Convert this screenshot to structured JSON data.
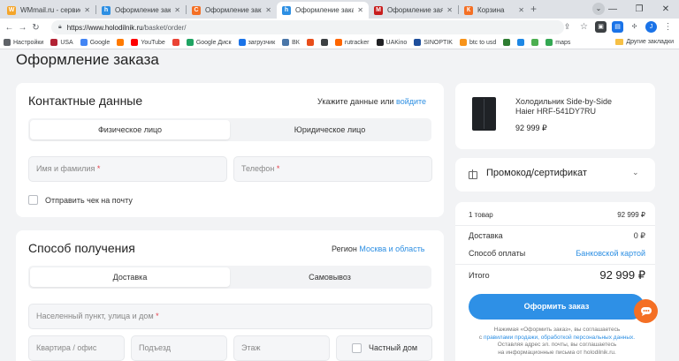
{
  "browser": {
    "tabs": [
      {
        "title": "WMmail.ru - сервис по",
        "favicon_color": "#f4a52a",
        "favicon": "W"
      },
      {
        "title": "Оформление заказа | и",
        "favicon_color": "#2d8fe3",
        "favicon": "h"
      },
      {
        "title": "Оформление заказа",
        "favicon_color": "#f46f24",
        "favicon": "C"
      },
      {
        "title": "Оформление заказа | и",
        "favicon_color": "#2d8fe3",
        "favicon": "h"
      },
      {
        "title": "Оформление заявки",
        "favicon_color": "#c81d1d",
        "favicon": "M"
      },
      {
        "title": "Корзина",
        "favicon_color": "#f46f24",
        "favicon": "К"
      }
    ],
    "url_host": "https://www.holodilnik.ru",
    "url_path": "/basket/order/",
    "bookmarks": [
      {
        "label": "Настройки",
        "color": "#5f6368"
      },
      {
        "label": "USA",
        "color": "#b22234"
      },
      {
        "label": "Google",
        "color": "#4285f4"
      },
      {
        "label": "",
        "color": "#ff7a00"
      },
      {
        "label": "YouTube",
        "color": "#ff0000"
      },
      {
        "label": "",
        "color": "#ea4335"
      },
      {
        "label": "Google Диск",
        "color": "#1fa463"
      },
      {
        "label": "загрузчик",
        "color": "#1a73e8"
      },
      {
        "label": "ВК",
        "color": "#4a76a8"
      },
      {
        "label": "",
        "color": "#e84e1b"
      },
      {
        "label": "",
        "color": "#3c4043"
      },
      {
        "label": "rutracker",
        "color": "#ff6600"
      },
      {
        "label": "UAKino",
        "color": "#202124"
      },
      {
        "label": "SINOPTIK",
        "color": "#1e4f9c"
      },
      {
        "label": "btc to usd",
        "color": "#f7931a"
      },
      {
        "label": "",
        "color": "#2e7d32"
      },
      {
        "label": "",
        "color": "#1e88e5"
      },
      {
        "label": "",
        "color": "#4caf50"
      },
      {
        "label": "maps",
        "color": "#34a853"
      }
    ],
    "other_bookmarks": "Другие закладки"
  },
  "page": {
    "title": "Оформление заказа",
    "contacts": {
      "title": "Контактные данные",
      "hint": "Укажите данные или",
      "hint_link": "войдите",
      "tab_individual": "Физическое лицо",
      "tab_legal": "Юридическое лицо",
      "name_placeholder": "Имя и фамилия",
      "phone_placeholder": "Телефон",
      "required_mark": "*",
      "receipt_label": "Отправить чек на почту"
    },
    "delivery": {
      "title": "Способ получения",
      "region_label": "Регион",
      "region_value": "Москва и область",
      "tab_delivery": "Доставка",
      "tab_pickup": "Самовывоз",
      "address_placeholder": "Населенный пункт, улица и дом",
      "apartment_placeholder": "Квартира / офис",
      "entrance_placeholder": "Подъезд",
      "floor_placeholder": "Этаж",
      "private_house_label": "Частный дом"
    },
    "product": {
      "name": "Холодильник Side-by-Side Haier HRF-541DY7RU",
      "price": "92 999 ₽"
    },
    "promo": {
      "title": "Промокод/сертификат",
      "chevron": "⌄"
    },
    "summary": {
      "items_label": "1 товар",
      "items_value": "92 999 ₽",
      "delivery_label": "Доставка",
      "delivery_value": "0 ₽",
      "payment_label": "Способ оплаты",
      "payment_value": "Банковской картой",
      "total_label": "Итого",
      "total_value": "92 999 ₽",
      "order_button": "Оформить заказ",
      "legal_line1": "Нажимая «Оформить заказ», вы соглашаетесь",
      "legal_prefix": "с ",
      "legal_link": "правилами продажи, обработкой персональных данных.",
      "legal_line3": "Оставляя адрес эл. почты, вы соглашаетесь",
      "legal_line4": "на информационные письма от holodilnik.ru."
    }
  }
}
